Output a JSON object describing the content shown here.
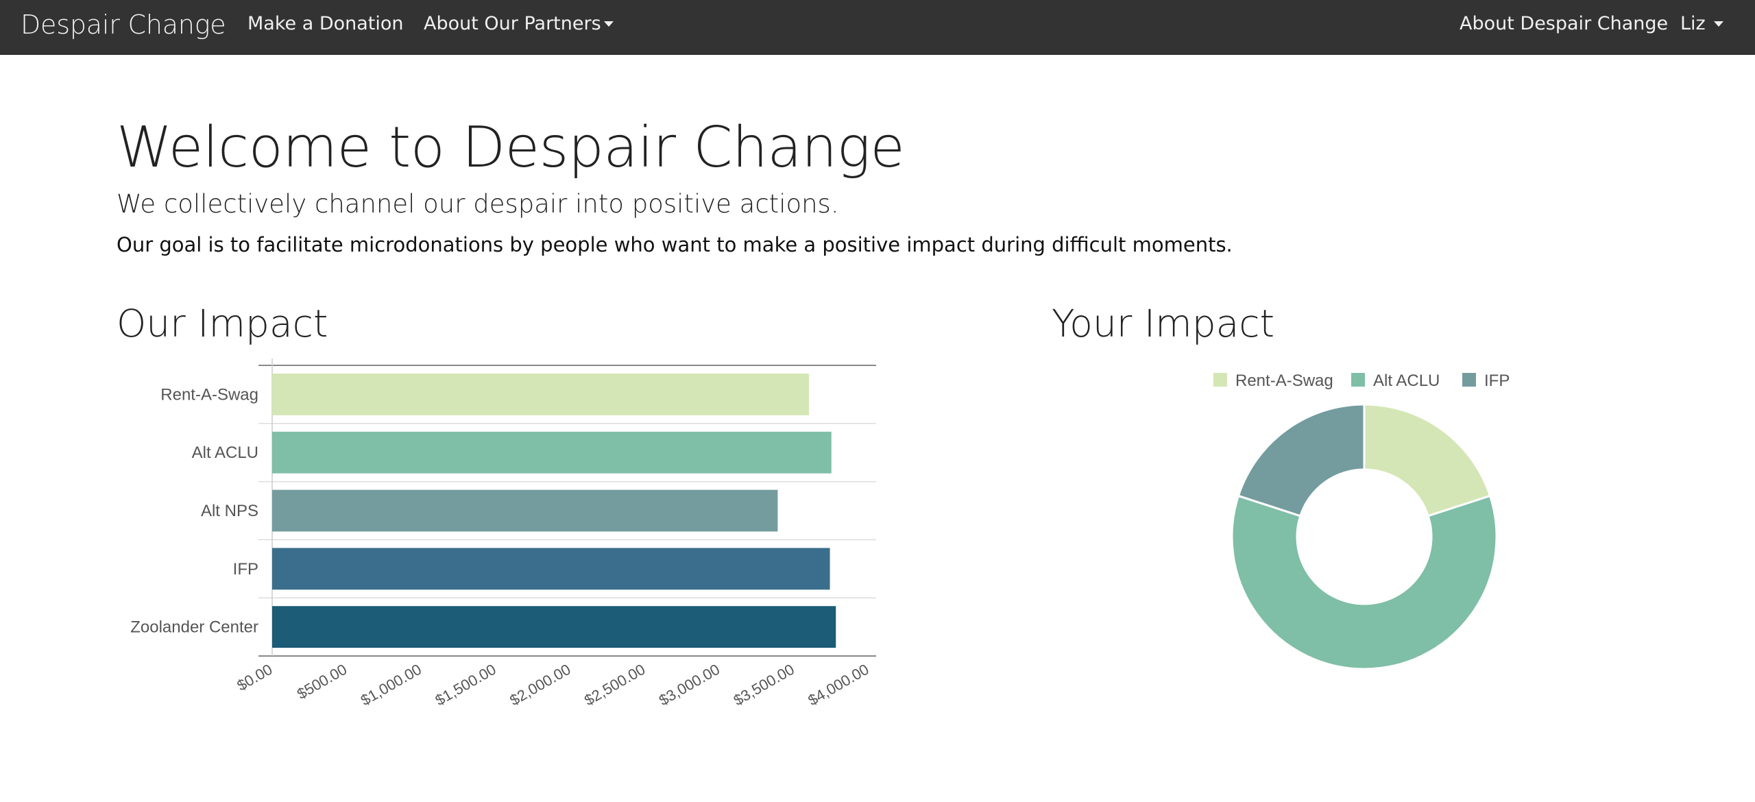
{
  "nav": {
    "brand": "Despair Change",
    "donate": "Make a Donation",
    "partners": "About Our Partners",
    "about": "About Despair Change",
    "user": "Liz"
  },
  "header": {
    "title": "Welcome to Despair Change",
    "subtitle": "We collectively channel our despair into positive actions.",
    "goal": "Our goal is to facilitate microdonations by people who want to make a positive impact during difficult moments."
  },
  "sections": {
    "our_impact": "Our Impact",
    "your_impact": "Your Impact"
  },
  "chart_data": [
    {
      "type": "bar",
      "orientation": "horizontal",
      "categories": [
        "Rent-A-Swag",
        "Alt ACLU",
        "Alt NPS",
        "IFP",
        "Zoolander Center"
      ],
      "values": [
        3600,
        3750,
        3390,
        3740,
        3780
      ],
      "colors": [
        "#d4e6b5",
        "#7fbea7",
        "#749c9f",
        "#3a6e8c",
        "#1c5c76"
      ],
      "xlim": [
        0,
        4050
      ],
      "xticks": [
        0,
        500,
        1000,
        1500,
        2000,
        2500,
        3000,
        3500,
        4000
      ],
      "xtick_labels": [
        "$0.00",
        "$500.00",
        "$1,000.00",
        "$1,500.00",
        "$2,000.00",
        "$2,500.00",
        "$3,000.00",
        "$3,500.00",
        "$4,000.00"
      ],
      "grid": true
    },
    {
      "type": "pie",
      "style": "donut",
      "labels": [
        "Rent-A-Swag",
        "Alt ACLU",
        "IFP"
      ],
      "values": [
        20,
        60,
        20
      ],
      "colors": [
        "#d4e6b5",
        "#7fbea7",
        "#749c9f"
      ],
      "legend": "top"
    }
  ]
}
